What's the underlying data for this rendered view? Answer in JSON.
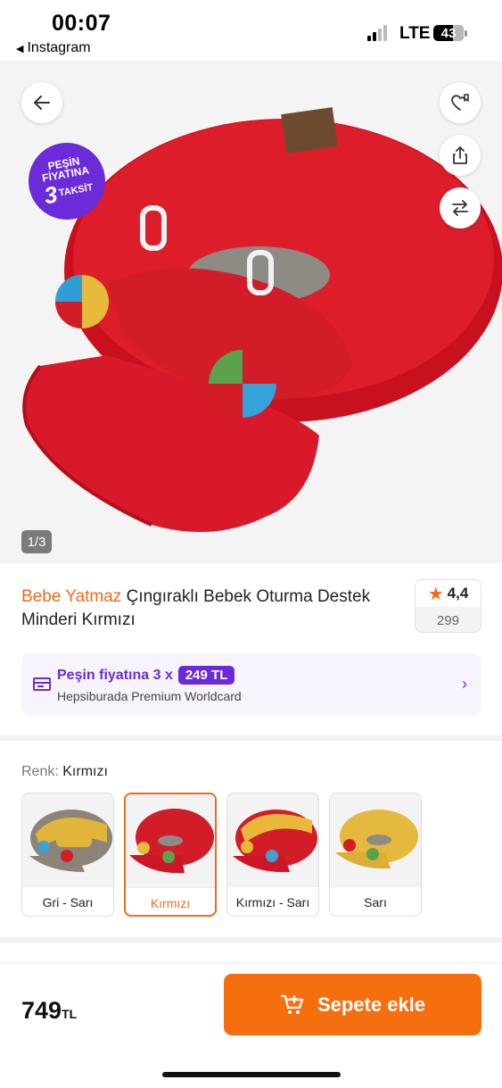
{
  "status_bar": {
    "time": "00:07",
    "back_app": "Instagram",
    "network": "LTE",
    "battery": "43"
  },
  "hero": {
    "badge": {
      "line1": "PEŞİN",
      "line2": "FİYATINA",
      "number": "3",
      "word": "TAKSİT"
    },
    "image_counter": "1/3",
    "icons": [
      "back-arrow-icon",
      "heart-list-icon",
      "share-icon",
      "compare-icon"
    ]
  },
  "product": {
    "brand": "Bebe Yatmaz",
    "name": " Çıngıraklı Bebek Oturma Destek Minderi Kırmızı",
    "rating": "4,4",
    "review_count": "299"
  },
  "installment": {
    "text": "Peşin fiyatına 3 x",
    "amount": "249 TL",
    "card_name": "Hepsiburada Premium Worldcard"
  },
  "color": {
    "label": "Renk:",
    "selected": "Kırmızı",
    "options": [
      {
        "name": "Gri - Sarı",
        "base": "#8c8479",
        "accent": "#e0b53a"
      },
      {
        "name": "Kırmızı",
        "base": "#d21c28",
        "accent": "#d21c28"
      },
      {
        "name": "Kırmızı - Sarı",
        "base": "#d21c28",
        "accent": "#e8b83a"
      },
      {
        "name": "Sarı",
        "base": "#e5b93d",
        "accent": "#e5b93d"
      }
    ]
  },
  "purchase": {
    "price": "749",
    "currency": "TL",
    "add_to_cart": "Sepete ekle"
  },
  "colors": {
    "brand_orange": "#f66f0f",
    "installment_purple": "#6c2bd9",
    "product_red": "#d21c28"
  }
}
